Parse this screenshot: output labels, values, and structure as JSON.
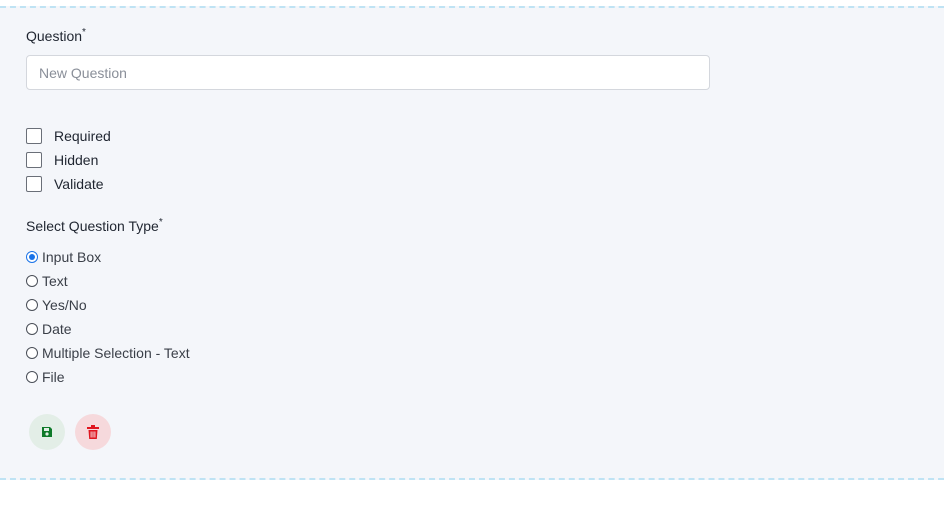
{
  "form": {
    "question_label": "Question",
    "required_mark": "*",
    "question_placeholder": "New Question",
    "question_value": "",
    "options": {
      "required": "Required",
      "hidden": "Hidden",
      "validate": "Validate"
    },
    "type_label": "Select Question Type",
    "types": [
      {
        "label": "Input Box",
        "checked": true
      },
      {
        "label": "Text",
        "checked": false
      },
      {
        "label": "Yes/No",
        "checked": false
      },
      {
        "label": "Date",
        "checked": false
      },
      {
        "label": "Multiple Selection - Text",
        "checked": false
      },
      {
        "label": "File",
        "checked": false
      }
    ],
    "buttons": {
      "save_icon": "save-icon",
      "delete_icon": "trash-icon"
    }
  },
  "colors": {
    "panel_bg": "#f4f6fa",
    "dashed_border": "#bfe3f4",
    "radio_selected": "#1a73e8",
    "save_icon": "#0f7a2a",
    "save_bg": "#e3eee7",
    "delete_icon": "#e0151f",
    "delete_bg": "#f6d9dc"
  }
}
